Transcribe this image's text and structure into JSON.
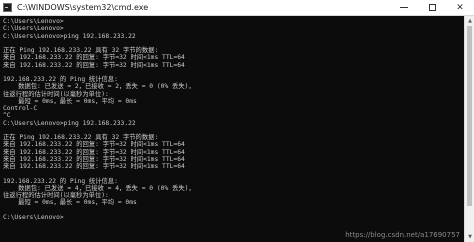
{
  "window": {
    "title": "C:\\WINDOWS\\system32\\cmd.exe",
    "icon": "console-icon",
    "controls": {
      "minimize": "minimize-icon",
      "maximize": "maximize-icon",
      "close": "close-icon",
      "close_glyph": "✕"
    }
  },
  "console": {
    "background": "#0c0c0c",
    "foreground": "#cccccc",
    "lines": [
      "C:\\Users\\Lenovo>",
      "C:\\Users\\Lenovo>",
      "C:\\Users\\Lenovo>ping 192.168.233.22",
      "",
      "正在 Ping 192.168.233.22 具有 32 字节的数据:",
      "来自 192.168.233.22 的回复: 字节=32 时间<1ms TTL=64",
      "来自 192.168.233.22 的回复: 字节=32 时间<1ms TTL=64",
      "",
      "192.168.233.22 的 Ping 统计信息:",
      "    数据包: 已发送 = 2，已接收 = 2，丢失 = 0 (0% 丢失)，",
      "往返行程的估计时间(以毫秒为单位):",
      "    最短 = 0ms，最长 = 0ms，平均 = 0ms",
      "Control-C",
      "^C",
      "C:\\Users\\Lenovo>ping 192.168.233.22",
      "",
      "正在 Ping 192.168.233.22 具有 32 字节的数据:",
      "来自 192.168.233.22 的回复: 字节=32 时间<1ms TTL=64",
      "来自 192.168.233.22 的回复: 字节=32 时间<1ms TTL=64",
      "来自 192.168.233.22 的回复: 字节=32 时间<1ms TTL=64",
      "来自 192.168.233.22 的回复: 字节=32 时间<1ms TTL=64",
      "",
      "192.168.233.22 的 Ping 统计信息:",
      "    数据包: 已发送 = 4，已接收 = 4，丢失 = 0 (0% 丢失)，",
      "往返行程的估计时间(以毫秒为单位):",
      "    最短 = 0ms，最长 = 0ms，平均 = 0ms",
      "",
      "C:\\Users\\Lenovo>"
    ]
  },
  "scrollbar": {
    "up_icon": "scroll-up-arrow-icon",
    "down_icon": "scroll-down-arrow-icon",
    "up_glyph": "▲",
    "down_glyph": "▼"
  },
  "watermark": {
    "text": "https://blog.csdn.net/a17690757"
  }
}
